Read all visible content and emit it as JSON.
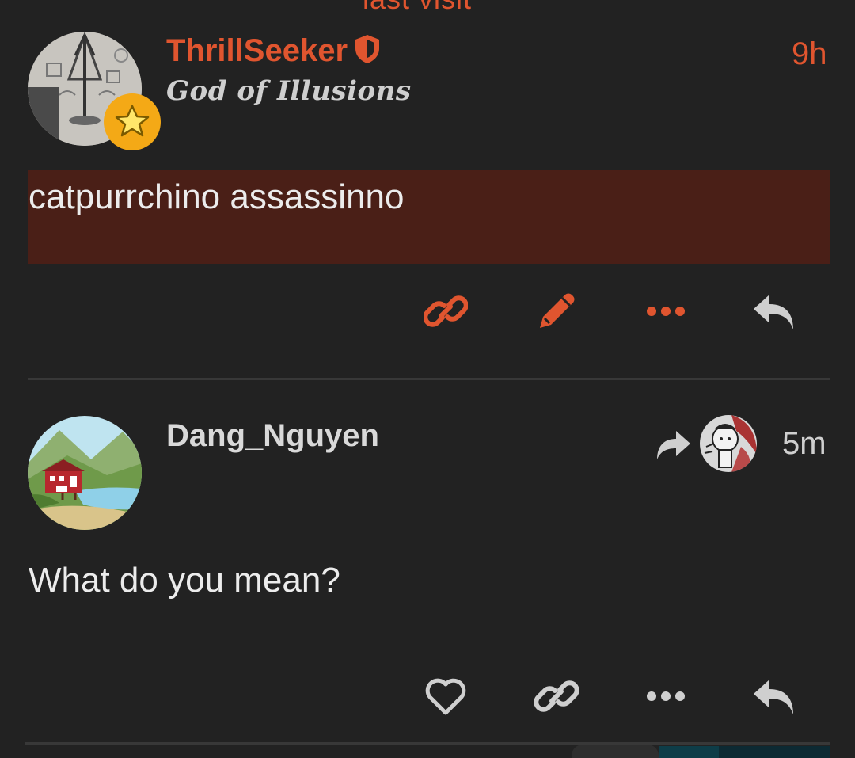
{
  "header": {
    "cut_text": "last visit"
  },
  "posts": [
    {
      "username": "ThrillSeeker",
      "user_title": "God of Illusions",
      "time": "9h",
      "body": "catpurrchino assassinno",
      "username_color": "#e0552f",
      "actions": [
        "link-icon",
        "pencil-icon",
        "more-icon",
        "reply-icon"
      ]
    },
    {
      "username": "Dang_Nguyen",
      "time": "5m",
      "body": "What do you mean?",
      "reply_to_avatar": "cat-avatar",
      "actions": [
        "heart-icon",
        "link-icon",
        "more-icon",
        "reply-icon"
      ]
    }
  ],
  "colors": {
    "background": "#222222",
    "accent": "#e0552f",
    "highlight": "#4a1f17",
    "icon_gray": "#cfcfcf"
  }
}
